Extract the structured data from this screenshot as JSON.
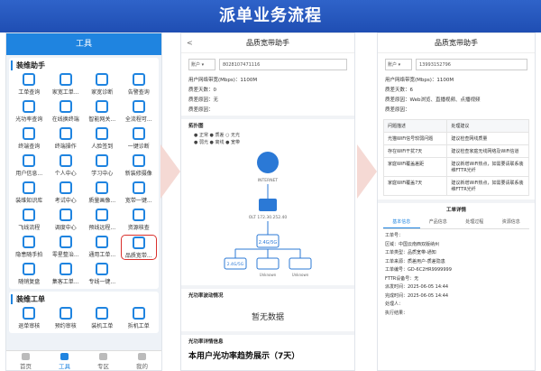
{
  "banner": "派单业务流程",
  "tools": {
    "header": "工具",
    "sections": [
      {
        "title": "装维助手",
        "items": [
          "工单查询",
          "家宽工单...",
          "家宽诊断",
          "告警查询",
          "光功率查询",
          "在线换终端",
          "智能网关...",
          "全流程可...",
          "终端查询",
          "终端操作",
          "人脸签到",
          "一键诊断",
          "用户信息...",
          "个人中心",
          "学习中心",
          "新装修摄像",
          "装维知识库",
          "考试中心",
          "质量画像...",
          "宽带一键...",
          "飞线流程",
          "调度中心",
          "预线远程...",
          "资源核查",
          "隐患随手拍",
          "零星整治...",
          "通用工单...",
          "品质宽带...",
          "随销复盘",
          "集客工单...",
          "专线一键..."
        ]
      },
      {
        "title": "装维工单",
        "items": [
          "退单审核",
          "预约审核",
          "装机工单",
          "拆机工单"
        ]
      }
    ],
    "highlighted": "品质宽带...",
    "tabbar": [
      "首页",
      "工具",
      "专区",
      "我的"
    ]
  },
  "helper": {
    "title": "品质宽带助手",
    "back": "<",
    "select_type": "账户 ▾",
    "select_value": "8028107471116",
    "info": [
      "用户网络带宽(Mbps)：1100M",
      "质差天数：0",
      "质差原因：无",
      "质差原因："
    ],
    "topology_label": "拓扑图",
    "legend": [
      "● 正常  ● 质差  ○ 无光",
      "● 弱光  ● 离线  ● 宽带"
    ],
    "nodes": [
      "INTERNET",
      "OLT 172.30.252.40",
      "2.4G/5G",
      "2.4G/5G",
      "Unknown",
      "Unknown"
    ],
    "fault_label": "光功率波动情况",
    "nodata": "暂无数据",
    "trend_label": "光功率详情信息",
    "trend": "本用户光功率趋势展示（7天）"
  },
  "detail": {
    "title": "品质宽带助手",
    "select_type": "账户 ▾",
    "select_value": "13993152796",
    "info": [
      "用户网络带宽(Mbps)：1100M",
      "质差天数：6",
      "质差原因：Web浏览、直播视频、点播视频",
      "质差原因："
    ],
    "table_header": [
      "问题描述",
      "处理建议"
    ],
    "table_rows": [
      [
        "光猫WiFi信号较弱问题",
        "建议检查网线质量"
      ],
      [
        "存在WiFi干扰7天",
        "建议检查家庭无线网络及WiFi信道"
      ],
      [
        "家庭WiFi覆盖差距",
        "建议新增WiFi热点，如需要请联系装维FTTR光纤"
      ],
      [
        "家庭WiFi覆盖7天",
        "建议新增WiFi热点，如需要请联系装维FTTR光纤"
      ]
    ],
    "order_label": "工单详情",
    "tabs": [
      "基本信息",
      "产品信息",
      "处理过程",
      "资源信息"
    ],
    "kv": [
      "工单号：",
      "区域：中国云南西双版纳州",
      "工单类型：品质宽带-通知",
      "工单来源：质差用户-质差隐患",
      "工单编号：GD-6C2HR9999999",
      "FTTR设备号：无",
      "派发时间：2025-06-05 14:44",
      "完成时间：2025-06-05 14:44",
      "处理人：",
      "执行结果："
    ]
  }
}
